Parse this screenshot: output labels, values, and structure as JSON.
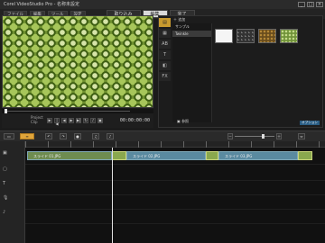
{
  "window": {
    "title": "Corel VideoStudio Pro - 名称未設定"
  },
  "menu": [
    "ファイル",
    "編集",
    "ツール",
    "設定"
  ],
  "steps": [
    {
      "label": "取り込み"
    },
    {
      "label": "編集",
      "active": true
    },
    {
      "label": "完了"
    }
  ],
  "player": {
    "mode_label": "Project",
    "clip_label": "Clip",
    "timecode": "00:00:00:00"
  },
  "library": {
    "add_label": "追加",
    "tree": [
      "サンプル",
      "Twinkle"
    ],
    "browse_label": "参照",
    "badge": "オプション"
  },
  "timeline": {
    "clips": [
      "スライド 01.JPG",
      "スライド 02.JPG",
      "スライド 03.JPG"
    ]
  }
}
